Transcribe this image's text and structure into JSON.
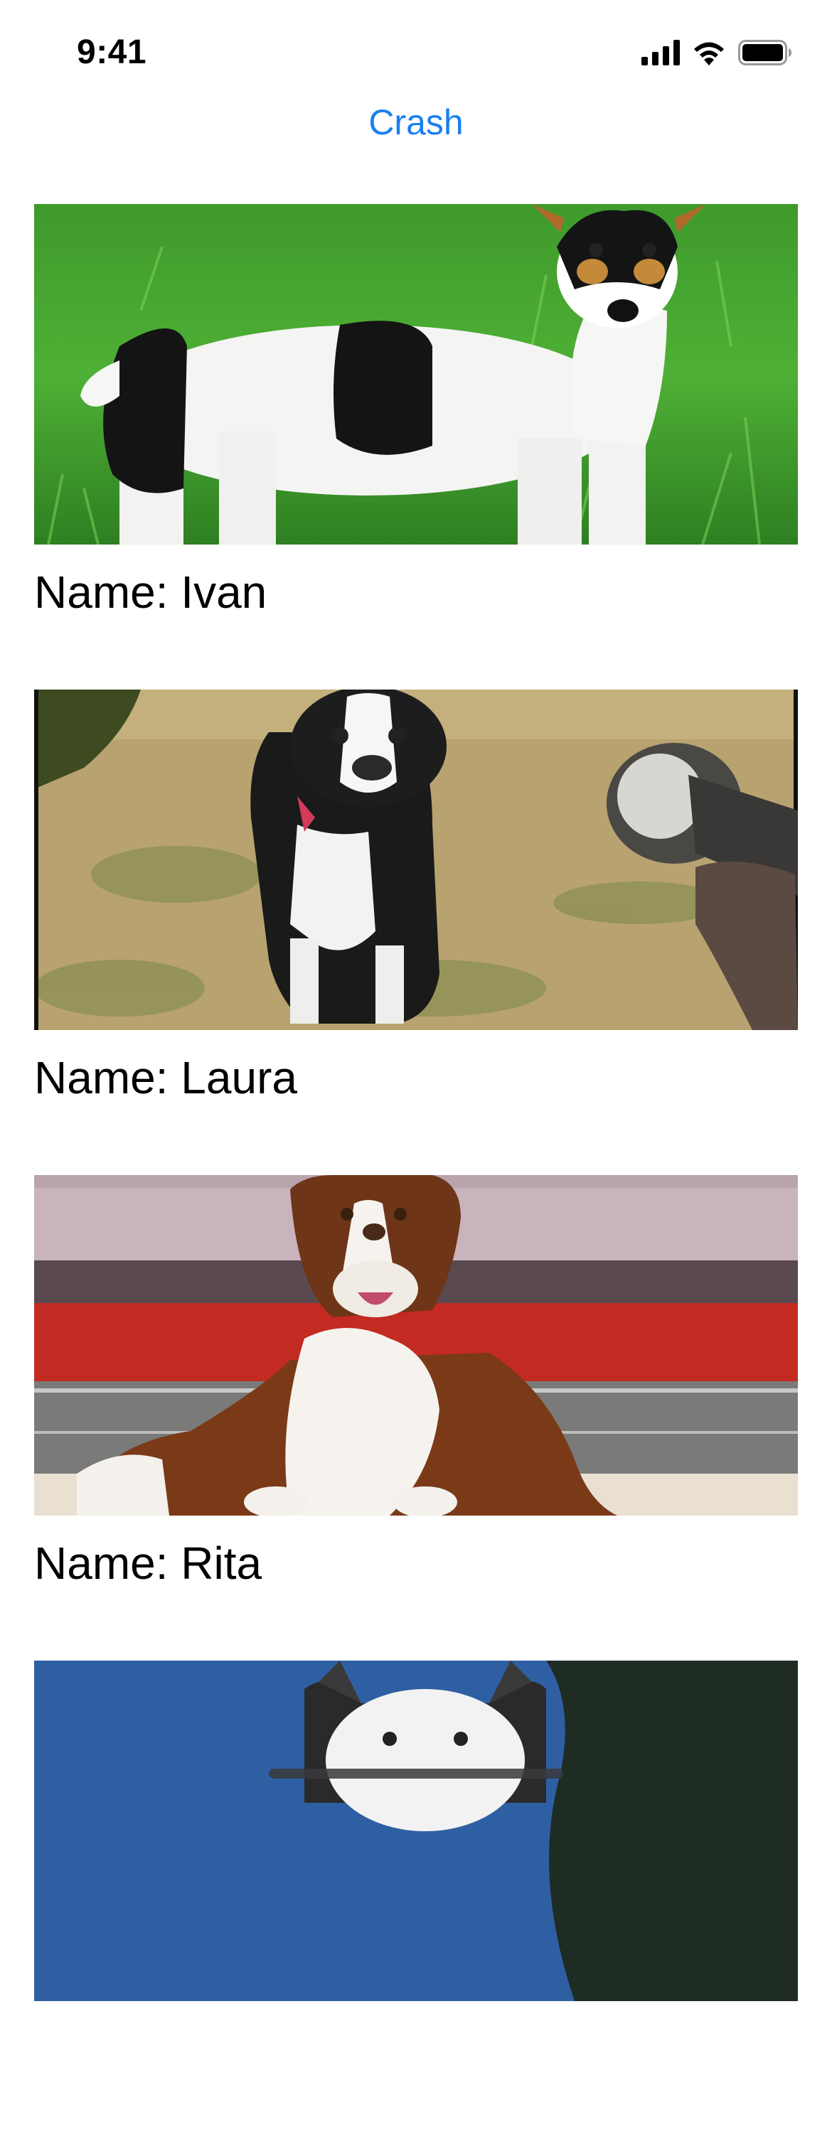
{
  "status_bar": {
    "time": "9:41",
    "icons": [
      "signal-icon",
      "wifi-icon",
      "battery-icon"
    ]
  },
  "nav": {
    "crash_label": "Crash",
    "accent_color": "#1a7ff0"
  },
  "dogs": [
    {
      "label": "Name: Ivan",
      "photo": "jack-russell-terrier-on-grass"
    },
    {
      "label": "Name: Laura",
      "photo": "boston-terrier-with-hose"
    },
    {
      "label": "Name: Rita",
      "photo": "border-collie-lying-down"
    },
    {
      "label": "",
      "photo": "husky-under-blue-sky"
    }
  ]
}
